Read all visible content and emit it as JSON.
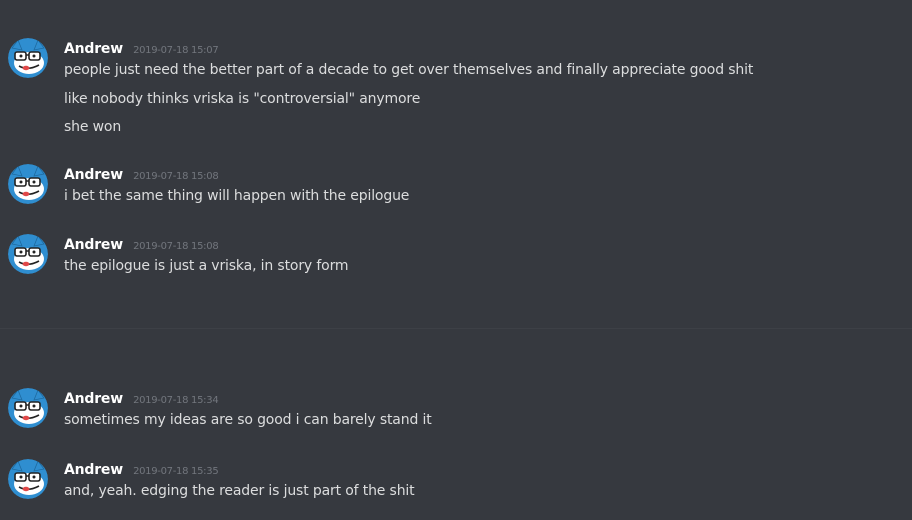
{
  "colors": {
    "background": "#36393f",
    "username": "#ffffff",
    "message": "#dcddde",
    "timestamp": "#72767d",
    "avatar_blue": "#2f8ed0",
    "avatar_tongue": "#e04848"
  },
  "avatar_icon": "cartoon-avatar-icon",
  "messages": [
    {
      "username": "Andrew",
      "timestamp": "2019-07-18 15:07",
      "lines": [
        "people just need the better part of a decade to get over themselves and finally appreciate good shit",
        "like nobody thinks vriska is \"controversial\" anymore",
        "she won"
      ]
    },
    {
      "username": "Andrew",
      "timestamp": "2019-07-18 15:08",
      "lines": [
        "i bet the same thing will happen with the epilogue"
      ]
    },
    {
      "username": "Andrew",
      "timestamp": "2019-07-18 15:08",
      "lines": [
        "the epilogue is just a vriska, in story form"
      ]
    },
    {
      "username": "Andrew",
      "timestamp": "2019-07-18 15:34",
      "lines": [
        "sometimes my ideas are so good i can barely stand it"
      ]
    },
    {
      "username": "Andrew",
      "timestamp": "2019-07-18 15:35",
      "lines": [
        "and, yeah. edging the reader is just part of the shit"
      ]
    }
  ]
}
